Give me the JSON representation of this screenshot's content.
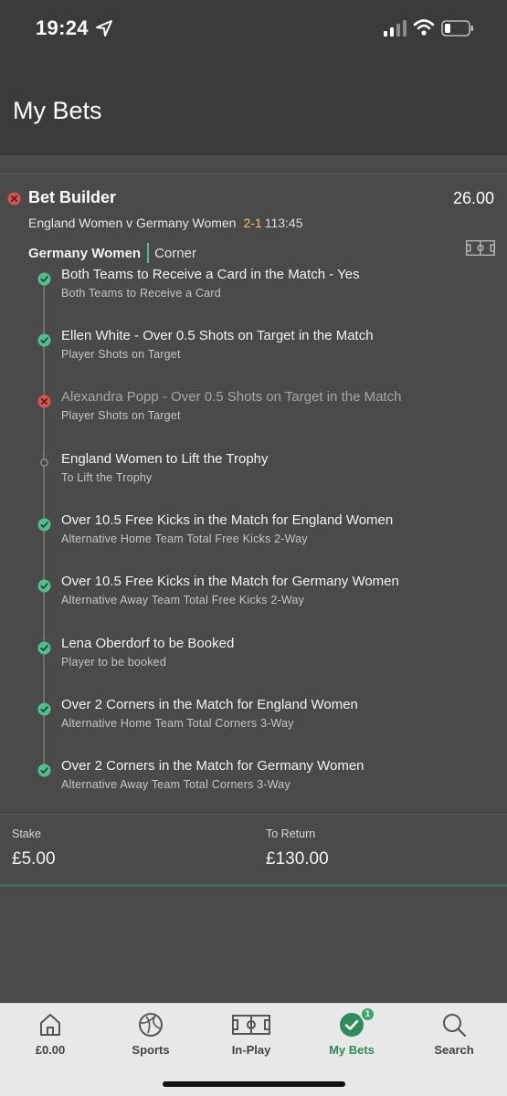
{
  "status_bar": {
    "time": "19:24"
  },
  "header": {
    "title": "My Bets"
  },
  "bet": {
    "type": "Bet Builder",
    "odds": "26.00",
    "match": "England Women v Germany Women",
    "score": "2-1",
    "clock": "113:45",
    "team": "Germany Women",
    "event": "Corner",
    "legs": [
      {
        "title": "Both Teams to Receive a Card in the Match - Yes",
        "market": "Both Teams to Receive a Card",
        "status": "won"
      },
      {
        "title": "Ellen White - Over 0.5 Shots on Target in the Match",
        "market": "Player Shots on Target",
        "status": "won"
      },
      {
        "title": "Alexandra Popp - Over 0.5 Shots on Target in the Match",
        "market": "Player Shots on Target",
        "status": "lost"
      },
      {
        "title": "England Women to Lift the Trophy",
        "market": "To Lift the Trophy",
        "status": "pending"
      },
      {
        "title": "Over 10.5 Free Kicks in the Match for England Women",
        "market": "Alternative Home Team Total Free Kicks 2-Way",
        "status": "won"
      },
      {
        "title": "Over 10.5 Free Kicks in the Match for Germany Women",
        "market": "Alternative Away Team Total Free Kicks 2-Way",
        "status": "won"
      },
      {
        "title": "Lena Oberdorf to be Booked",
        "market": "Player to be booked",
        "status": "won"
      },
      {
        "title": "Over 2 Corners in the Match for England Women",
        "market": "Alternative Home Team Total Corners 3-Way",
        "status": "won"
      },
      {
        "title": "Over 2 Corners in the Match for Germany Women",
        "market": "Alternative Away Team Total Corners 3-Way",
        "status": "won"
      }
    ],
    "stake_label": "Stake",
    "stake": "£5.00",
    "return_label": "To Return",
    "return": "£130.00"
  },
  "tabbar": {
    "tabs": [
      {
        "label": "£0.00",
        "icon": "home-icon"
      },
      {
        "label": "Sports",
        "icon": "football-icon"
      },
      {
        "label": "In-Play",
        "icon": "pitch-icon"
      },
      {
        "label": "My Bets",
        "icon": "check-circle-icon",
        "badge": "1",
        "active": true
      },
      {
        "label": "Search",
        "icon": "search-icon"
      }
    ]
  },
  "colors": {
    "won": "#4fc08d",
    "lost": "#d9534f",
    "score": "#f2c94c",
    "accent": "#2e8b5c"
  }
}
